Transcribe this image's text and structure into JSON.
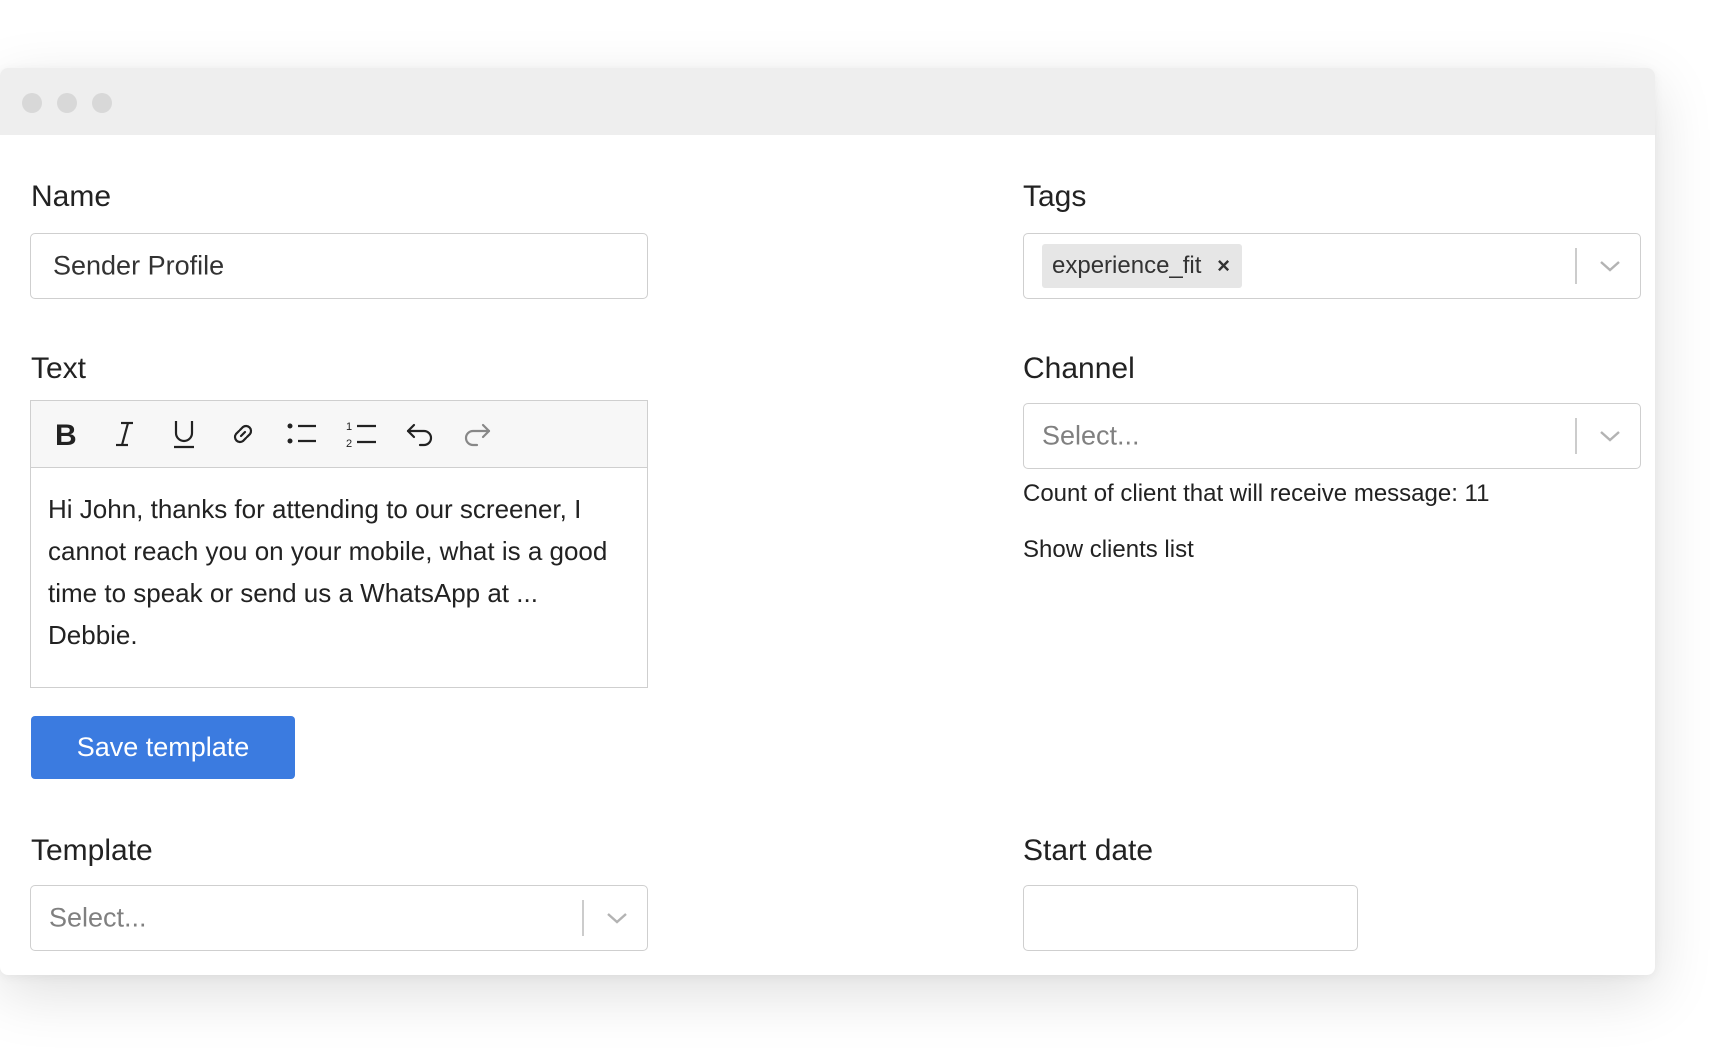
{
  "window": {
    "controls": [
      "close",
      "minimize",
      "maximize"
    ]
  },
  "name_field": {
    "label": "Name",
    "value": "Sender Profile"
  },
  "tags_field": {
    "label": "Tags",
    "tags": [
      "experience_fit"
    ],
    "remove_symbol": "×"
  },
  "text_field": {
    "label": "Text",
    "toolbar": [
      "bold-icon",
      "italic-icon",
      "underline-icon",
      "link-icon",
      "bulleted-list-icon",
      "numbered-list-icon",
      "undo-icon",
      "redo-icon"
    ],
    "content": "Hi John, thanks for attending to our screener, I cannot reach you on your mobile, what is a good time to speak or send us a WhatsApp at ... Debbie."
  },
  "channel_field": {
    "label": "Channel",
    "placeholder": "Select..."
  },
  "recipients": {
    "count_text": "Count of client that will receive message: 11",
    "show_list_link": "Show clients list"
  },
  "save_button": {
    "label": "Save template",
    "color": "#3b7be0"
  },
  "template_field": {
    "label": "Template",
    "placeholder": "Select..."
  },
  "start_date_field": {
    "label": "Start date",
    "value": ""
  }
}
